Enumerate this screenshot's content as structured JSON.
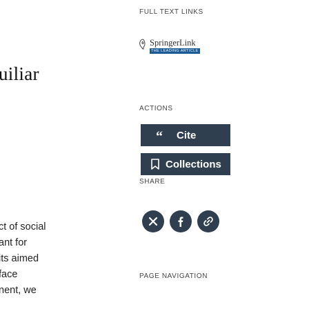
{
  "left_column": {
    "title": "uiliar",
    "body_lines": [
      "ct of social",
      "ant for",
      "its aimed",
      "face",
      "nent, we"
    ]
  },
  "sidebar": {
    "full_text_links_label": "FULL TEXT LINKS",
    "springer_link": {
      "name": "SpringerLink",
      "tagline": "THE LEADING ARTICLE"
    },
    "actions_label": "ACTIONS",
    "cite_label": "Cite",
    "collections_label": "Collections",
    "share_label": "SHARE",
    "share_icons": [
      "x-twitter-icon",
      "facebook-icon",
      "permalink-icon"
    ],
    "page_navigation_label": "PAGE NAVIGATION"
  },
  "colors": {
    "button_bg": "#2f3f4f",
    "springer_blue": "#1a5a96"
  }
}
